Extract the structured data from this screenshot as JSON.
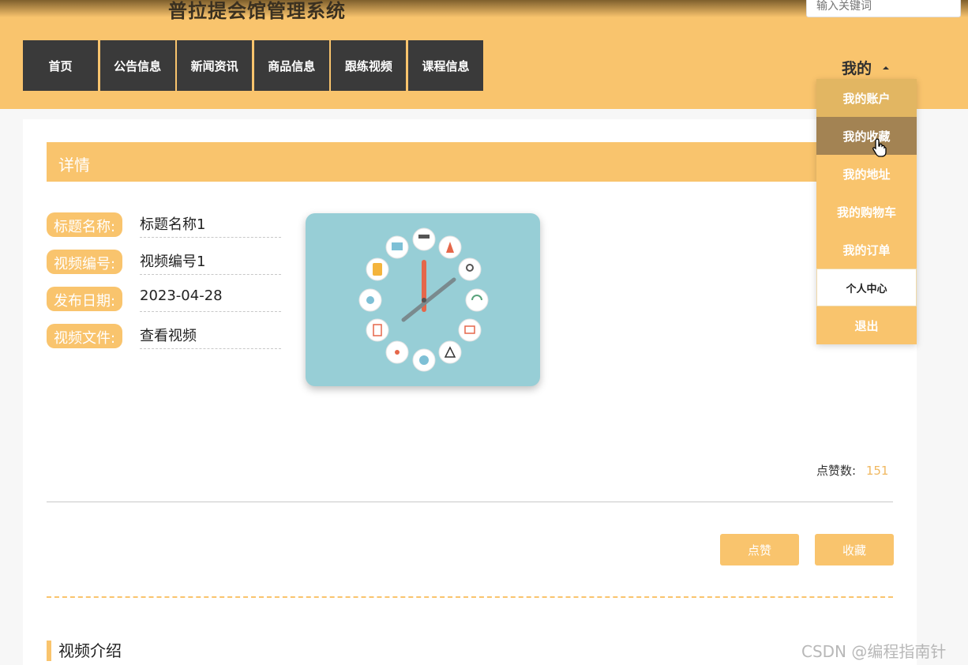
{
  "header": {
    "site_title": "普拉提会馆管理系统",
    "search_placeholder": "输入关键词",
    "nav": [
      "首页",
      "公告信息",
      "新闻资讯",
      "商品信息",
      "跟练视频",
      "课程信息"
    ],
    "my_menu_label": "我的"
  },
  "dropdown": {
    "items": [
      "我的账户",
      "我的收藏",
      "我的地址",
      "我的购物车",
      "我的订单",
      "个人中心",
      "退出"
    ],
    "active_item": "我的收藏"
  },
  "detail": {
    "header": "详情",
    "fields": [
      {
        "label": "标题名称:",
        "value": "标题名称1"
      },
      {
        "label": "视频编号:",
        "value": "视频编号1"
      },
      {
        "label": "发布日期:",
        "value": "2023-04-28"
      },
      {
        "label": "视频文件:",
        "value": "查看视频"
      }
    ],
    "likes_label": "点赞数:",
    "likes_count": "151",
    "like_button": "点赞",
    "favorite_button": "收藏",
    "section_title": "视频介绍"
  },
  "watermark": "CSDN @编程指南针",
  "colors": {
    "accent": "#f9c46d",
    "nav_bg": "#3a3a3a",
    "dropdown_active": "#a38353"
  }
}
